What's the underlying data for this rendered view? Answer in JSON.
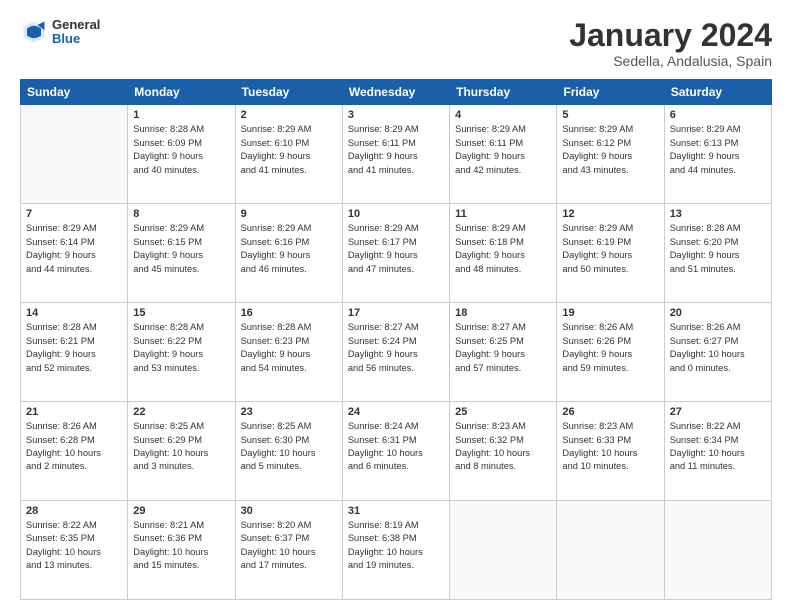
{
  "logo": {
    "general": "General",
    "blue": "Blue"
  },
  "header": {
    "title": "January 2024",
    "subtitle": "Sedella, Andalusia, Spain"
  },
  "weekdays": [
    "Sunday",
    "Monday",
    "Tuesday",
    "Wednesday",
    "Thursday",
    "Friday",
    "Saturday"
  ],
  "weeks": [
    [
      {
        "day": "",
        "info": ""
      },
      {
        "day": "1",
        "info": "Sunrise: 8:28 AM\nSunset: 6:09 PM\nDaylight: 9 hours\nand 40 minutes."
      },
      {
        "day": "2",
        "info": "Sunrise: 8:29 AM\nSunset: 6:10 PM\nDaylight: 9 hours\nand 41 minutes."
      },
      {
        "day": "3",
        "info": "Sunrise: 8:29 AM\nSunset: 6:11 PM\nDaylight: 9 hours\nand 41 minutes."
      },
      {
        "day": "4",
        "info": "Sunrise: 8:29 AM\nSunset: 6:11 PM\nDaylight: 9 hours\nand 42 minutes."
      },
      {
        "day": "5",
        "info": "Sunrise: 8:29 AM\nSunset: 6:12 PM\nDaylight: 9 hours\nand 43 minutes."
      },
      {
        "day": "6",
        "info": "Sunrise: 8:29 AM\nSunset: 6:13 PM\nDaylight: 9 hours\nand 44 minutes."
      }
    ],
    [
      {
        "day": "7",
        "info": "Sunrise: 8:29 AM\nSunset: 6:14 PM\nDaylight: 9 hours\nand 44 minutes."
      },
      {
        "day": "8",
        "info": "Sunrise: 8:29 AM\nSunset: 6:15 PM\nDaylight: 9 hours\nand 45 minutes."
      },
      {
        "day": "9",
        "info": "Sunrise: 8:29 AM\nSunset: 6:16 PM\nDaylight: 9 hours\nand 46 minutes."
      },
      {
        "day": "10",
        "info": "Sunrise: 8:29 AM\nSunset: 6:17 PM\nDaylight: 9 hours\nand 47 minutes."
      },
      {
        "day": "11",
        "info": "Sunrise: 8:29 AM\nSunset: 6:18 PM\nDaylight: 9 hours\nand 48 minutes."
      },
      {
        "day": "12",
        "info": "Sunrise: 8:29 AM\nSunset: 6:19 PM\nDaylight: 9 hours\nand 50 minutes."
      },
      {
        "day": "13",
        "info": "Sunrise: 8:28 AM\nSunset: 6:20 PM\nDaylight: 9 hours\nand 51 minutes."
      }
    ],
    [
      {
        "day": "14",
        "info": "Sunrise: 8:28 AM\nSunset: 6:21 PM\nDaylight: 9 hours\nand 52 minutes."
      },
      {
        "day": "15",
        "info": "Sunrise: 8:28 AM\nSunset: 6:22 PM\nDaylight: 9 hours\nand 53 minutes."
      },
      {
        "day": "16",
        "info": "Sunrise: 8:28 AM\nSunset: 6:23 PM\nDaylight: 9 hours\nand 54 minutes."
      },
      {
        "day": "17",
        "info": "Sunrise: 8:27 AM\nSunset: 6:24 PM\nDaylight: 9 hours\nand 56 minutes."
      },
      {
        "day": "18",
        "info": "Sunrise: 8:27 AM\nSunset: 6:25 PM\nDaylight: 9 hours\nand 57 minutes."
      },
      {
        "day": "19",
        "info": "Sunrise: 8:26 AM\nSunset: 6:26 PM\nDaylight: 9 hours\nand 59 minutes."
      },
      {
        "day": "20",
        "info": "Sunrise: 8:26 AM\nSunset: 6:27 PM\nDaylight: 10 hours\nand 0 minutes."
      }
    ],
    [
      {
        "day": "21",
        "info": "Sunrise: 8:26 AM\nSunset: 6:28 PM\nDaylight: 10 hours\nand 2 minutes."
      },
      {
        "day": "22",
        "info": "Sunrise: 8:25 AM\nSunset: 6:29 PM\nDaylight: 10 hours\nand 3 minutes."
      },
      {
        "day": "23",
        "info": "Sunrise: 8:25 AM\nSunset: 6:30 PM\nDaylight: 10 hours\nand 5 minutes."
      },
      {
        "day": "24",
        "info": "Sunrise: 8:24 AM\nSunset: 6:31 PM\nDaylight: 10 hours\nand 6 minutes."
      },
      {
        "day": "25",
        "info": "Sunrise: 8:23 AM\nSunset: 6:32 PM\nDaylight: 10 hours\nand 8 minutes."
      },
      {
        "day": "26",
        "info": "Sunrise: 8:23 AM\nSunset: 6:33 PM\nDaylight: 10 hours\nand 10 minutes."
      },
      {
        "day": "27",
        "info": "Sunrise: 8:22 AM\nSunset: 6:34 PM\nDaylight: 10 hours\nand 11 minutes."
      }
    ],
    [
      {
        "day": "28",
        "info": "Sunrise: 8:22 AM\nSunset: 6:35 PM\nDaylight: 10 hours\nand 13 minutes."
      },
      {
        "day": "29",
        "info": "Sunrise: 8:21 AM\nSunset: 6:36 PM\nDaylight: 10 hours\nand 15 minutes."
      },
      {
        "day": "30",
        "info": "Sunrise: 8:20 AM\nSunset: 6:37 PM\nDaylight: 10 hours\nand 17 minutes."
      },
      {
        "day": "31",
        "info": "Sunrise: 8:19 AM\nSunset: 6:38 PM\nDaylight: 10 hours\nand 19 minutes."
      },
      {
        "day": "",
        "info": ""
      },
      {
        "day": "",
        "info": ""
      },
      {
        "day": "",
        "info": ""
      }
    ]
  ]
}
